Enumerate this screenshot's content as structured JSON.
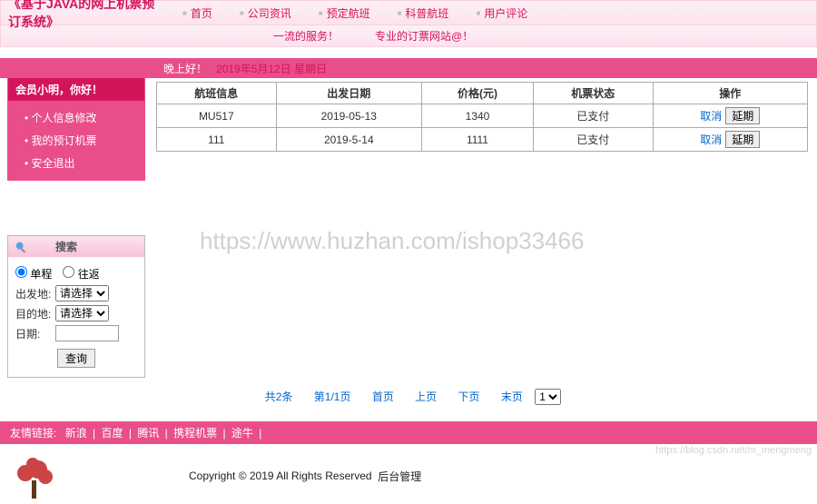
{
  "header": {
    "logo": "《基于JAVA的网上机票预订系统》",
    "nav": [
      "首页",
      "公司资讯",
      "预定航班",
      "科普航班",
      "用户评论"
    ]
  },
  "sub_bar": {
    "s1": "一流的服务！",
    "s2": "专业的订票网站@！"
  },
  "greet": {
    "text": "晚上好！",
    "date": "2019年5月12日 星期日"
  },
  "sidebar": {
    "title": "会员小明，你好！",
    "items": [
      "个人信息修改",
      "我的预订机票",
      "安全退出"
    ]
  },
  "search": {
    "title": "搜索",
    "radio1": "单程",
    "radio2": "往返",
    "from_lbl": "出发地:",
    "to_lbl": "目的地:",
    "date_lbl": "日期:",
    "default_opt": "请选择",
    "btn": "查询"
  },
  "table": {
    "headers": [
      "航班信息",
      "出发日期",
      "价格(元)",
      "机票状态",
      "操作"
    ],
    "rows": [
      {
        "flight": "MU517",
        "date": "2019-05-13",
        "price": "1340",
        "status": "已支付",
        "a1": "取消",
        "a2": "延期"
      },
      {
        "flight": "111",
        "date": "2019-5-14",
        "price": "1111",
        "status": "已支付",
        "a1": "取消",
        "a2": "延期"
      }
    ]
  },
  "pager": {
    "total": "共2条",
    "page": "第1/1页",
    "first": "首页",
    "prev": "上页",
    "next": "下页",
    "last": "末页",
    "sel": "1"
  },
  "links": {
    "label": "友情链接:",
    "items": [
      "新浪",
      "百度",
      "腾讯",
      "携程机票",
      "途牛"
    ]
  },
  "footer": {
    "copy": "Copyright © 2019 All Rights Reserved",
    "admin": "后台管理"
  },
  "watermark": "https://www.huzhan.com/ishop33466",
  "corner": "https://blog.csdn.net/m_mengmeng"
}
